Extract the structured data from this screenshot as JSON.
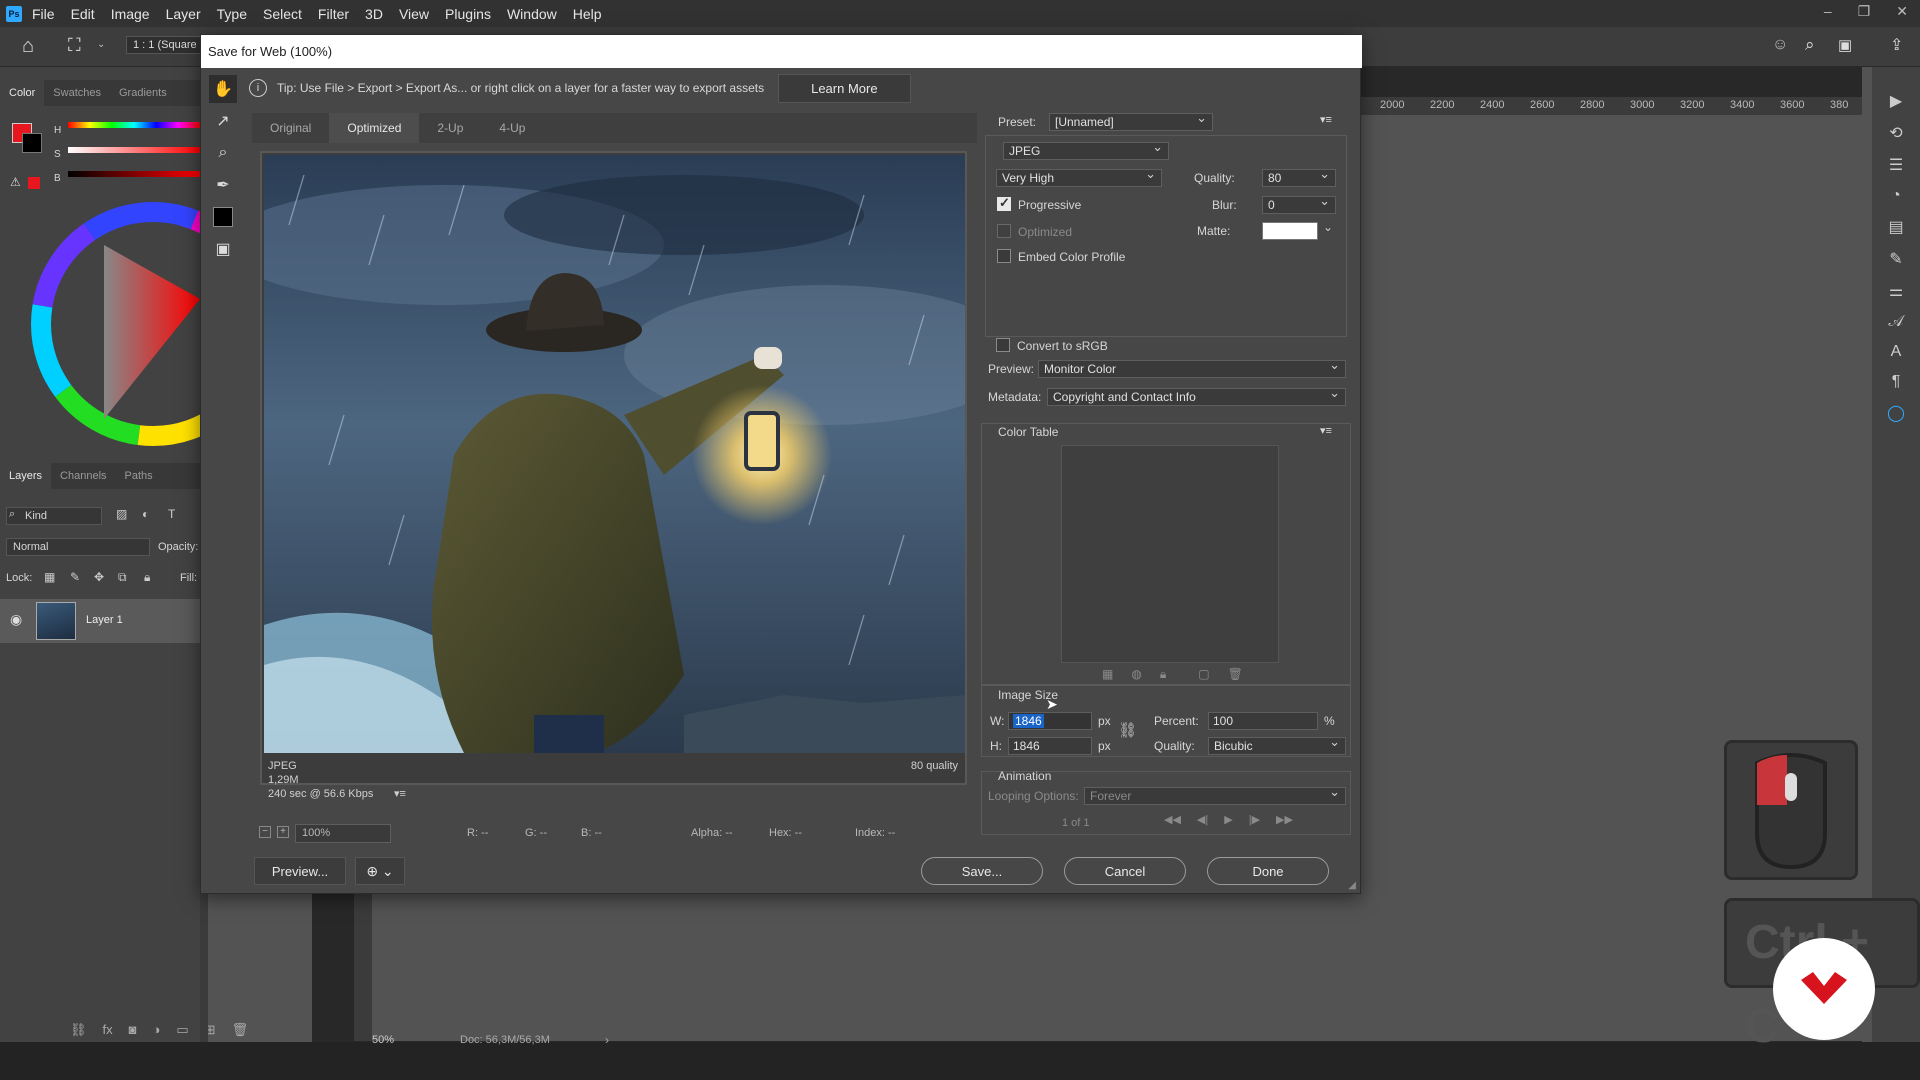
{
  "app": {
    "logo": "Ps"
  },
  "menu": [
    "File",
    "Edit",
    "Image",
    "Layer",
    "Type",
    "Select",
    "Filter",
    "3D",
    "View",
    "Plugins",
    "Window",
    "Help"
  ],
  "options_bar": {
    "ratio": "1 : 1 (Square"
  },
  "left_panel": {
    "color_tabs": [
      "Color",
      "Swatches",
      "Gradients"
    ],
    "hsb": [
      "H",
      "S",
      "B"
    ],
    "layers_tabs": [
      "Layers",
      "Channels",
      "Paths"
    ],
    "kind": "Kind",
    "blend_mode": "Normal",
    "opacity_label": "Opacity:",
    "lock_label": "Lock:",
    "fill_label": "Fill:",
    "layer_name": "Layer 1"
  },
  "ruler_h": [
    "2000",
    "2200",
    "2400",
    "2600",
    "2800",
    "3000",
    "3200",
    "3400",
    "3600",
    "380"
  ],
  "status": {
    "zoom": "50%",
    "doc": "Doc: 56,3M/56,3M"
  },
  "dialog": {
    "title": "Save for Web (100%)",
    "tip": "Tip: Use File > Export > Export As...  or right click on a layer for a faster way to export assets",
    "learn_more": "Learn More",
    "view_tabs": [
      "Original",
      "Optimized",
      "2-Up",
      "4-Up"
    ],
    "preview_info": {
      "format": "JPEG",
      "size": "1,29M",
      "time": "240 sec @ 56.6 Kbps",
      "quality": "80 quality"
    },
    "zoom": {
      "value": "100%",
      "r": "R: --",
      "g": "G: --",
      "b": "B: --",
      "alpha": "Alpha: --",
      "hex": "Hex: --",
      "index": "Index: --"
    },
    "buttons": {
      "preview": "Preview...",
      "save": "Save...",
      "cancel": "Cancel",
      "done": "Done"
    },
    "settings": {
      "preset_label": "Preset:",
      "preset_value": "[Unnamed]",
      "format": "JPEG",
      "compression": "Very High",
      "quality_label": "Quality:",
      "quality_value": "80",
      "progressive": "Progressive",
      "blur_label": "Blur:",
      "blur_value": "0",
      "optimized": "Optimized",
      "matte_label": "Matte:",
      "embed_profile": "Embed Color Profile",
      "convert_srgb": "Convert to sRGB",
      "preview_label": "Preview:",
      "preview_value": "Monitor Color",
      "metadata_label": "Metadata:",
      "metadata_value": "Copyright and Contact Info",
      "color_table": "Color Table",
      "image_size": "Image Size",
      "w_label": "W:",
      "w_value": "1846",
      "h_label": "H:",
      "h_value": "1846",
      "px": "px",
      "percent_label": "Percent:",
      "percent_value": "100",
      "percent_sign": "%",
      "resample_label": "Quality:",
      "resample_value": "Bicubic",
      "animation": "Animation",
      "looping_label": "Looping Options:",
      "looping_value": "Forever",
      "frame": "1 of 1"
    }
  },
  "overlay": {
    "ctrl_key": "Ctrl + C"
  },
  "colors": {
    "accent": "#31a8ff",
    "fg_swatch": "#e8161f",
    "logo_red": "#d7141e"
  }
}
